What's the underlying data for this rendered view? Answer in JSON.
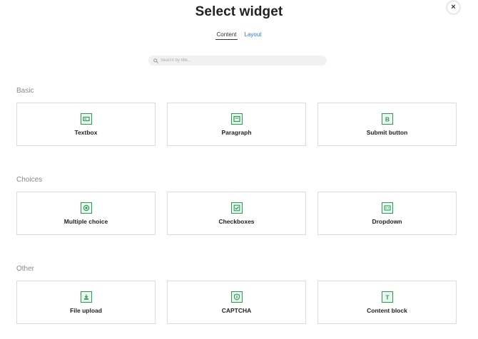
{
  "title": "Select widget",
  "close_label": "×",
  "tabs": [
    {
      "label": "Content"
    },
    {
      "label": "Layout"
    }
  ],
  "search": {
    "placeholder": "Search by title..."
  },
  "colors": {
    "accent": "#2e9a57",
    "link": "#2a7bd4"
  },
  "sections": [
    {
      "label": "Basic",
      "widgets": [
        {
          "label": "Textbox",
          "icon": "textbox-icon"
        },
        {
          "label": "Paragraph",
          "icon": "paragraph-icon"
        },
        {
          "label": "Submit button",
          "icon": "submit-button-icon"
        }
      ]
    },
    {
      "label": "Choices",
      "widgets": [
        {
          "label": "Multiple choice",
          "icon": "radio-icon"
        },
        {
          "label": "Checkboxes",
          "icon": "checkbox-icon"
        },
        {
          "label": "Dropdown",
          "icon": "dropdown-icon"
        }
      ]
    },
    {
      "label": "Other",
      "widgets": [
        {
          "label": "File upload",
          "icon": "upload-icon"
        },
        {
          "label": "CAPTCHA",
          "icon": "shield-icon"
        },
        {
          "label": "Content block",
          "icon": "text-block-icon"
        }
      ]
    }
  ]
}
